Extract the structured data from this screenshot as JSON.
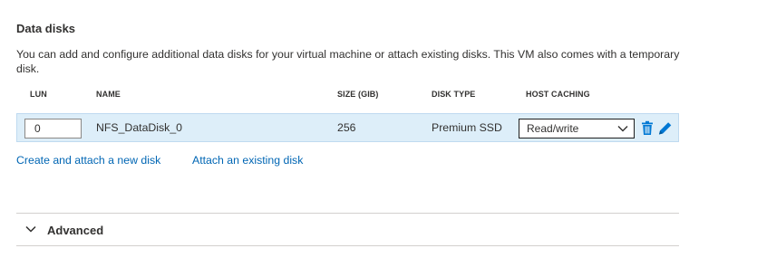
{
  "section": {
    "title": "Data disks",
    "description": "You can add and configure additional data disks for your virtual machine or attach existing disks. This VM also comes with a temporary disk."
  },
  "table": {
    "columns": {
      "lun": "LUN",
      "name": "NAME",
      "size": "SIZE (GIB)",
      "disk_type": "DISK TYPE",
      "host_caching": "HOST CACHING"
    },
    "rows": [
      {
        "lun": "0",
        "name": "NFS_DataDisk_0",
        "size": "256",
        "disk_type": "Premium SSD",
        "host_caching": "Read/write"
      }
    ]
  },
  "links": {
    "create_attach": "Create and attach a new disk",
    "attach_existing": "Attach an existing disk"
  },
  "advanced": {
    "label": "Advanced"
  },
  "icons": {
    "delete": "trash-icon",
    "edit": "pencil-icon",
    "dropdown": "chevron-down-icon",
    "expand": "chevron-down-icon"
  },
  "colors": {
    "link": "#0066b4",
    "row_highlight": "#ddeef9",
    "accent": "#0078d4"
  }
}
